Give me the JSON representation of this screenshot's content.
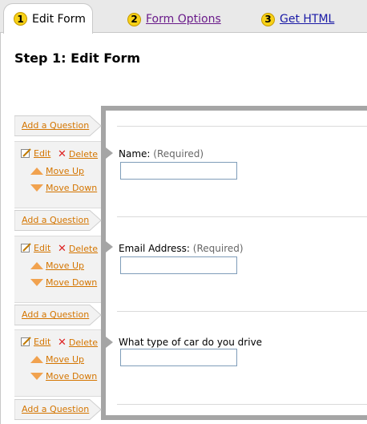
{
  "tabs": [
    {
      "num": "1",
      "label": "Edit Form"
    },
    {
      "num": "2",
      "label": "Form Options"
    },
    {
      "num": "3",
      "label": "Get HTML"
    }
  ],
  "page_title": "Step 1: Edit Form",
  "actions": {
    "add_question": "Add a Question",
    "edit": "Edit",
    "delete": "Delete",
    "move_up": "Move Up",
    "move_down": "Move Down"
  },
  "fields": [
    {
      "label": "Name:",
      "required": "(Required)",
      "value": ""
    },
    {
      "label": "Email Address:",
      "required": "(Required)",
      "value": ""
    },
    {
      "label": "What type of car do you drive",
      "required": "",
      "value": ""
    }
  ],
  "colors": {
    "link_orange": "#d47500",
    "tab_badge": "#f7d117",
    "panel_border": "#a5a5a5"
  },
  "icons": {
    "edit": "pencil-icon",
    "delete": "x-icon",
    "move_up": "arrow-up-icon",
    "move_down": "arrow-down-icon"
  }
}
